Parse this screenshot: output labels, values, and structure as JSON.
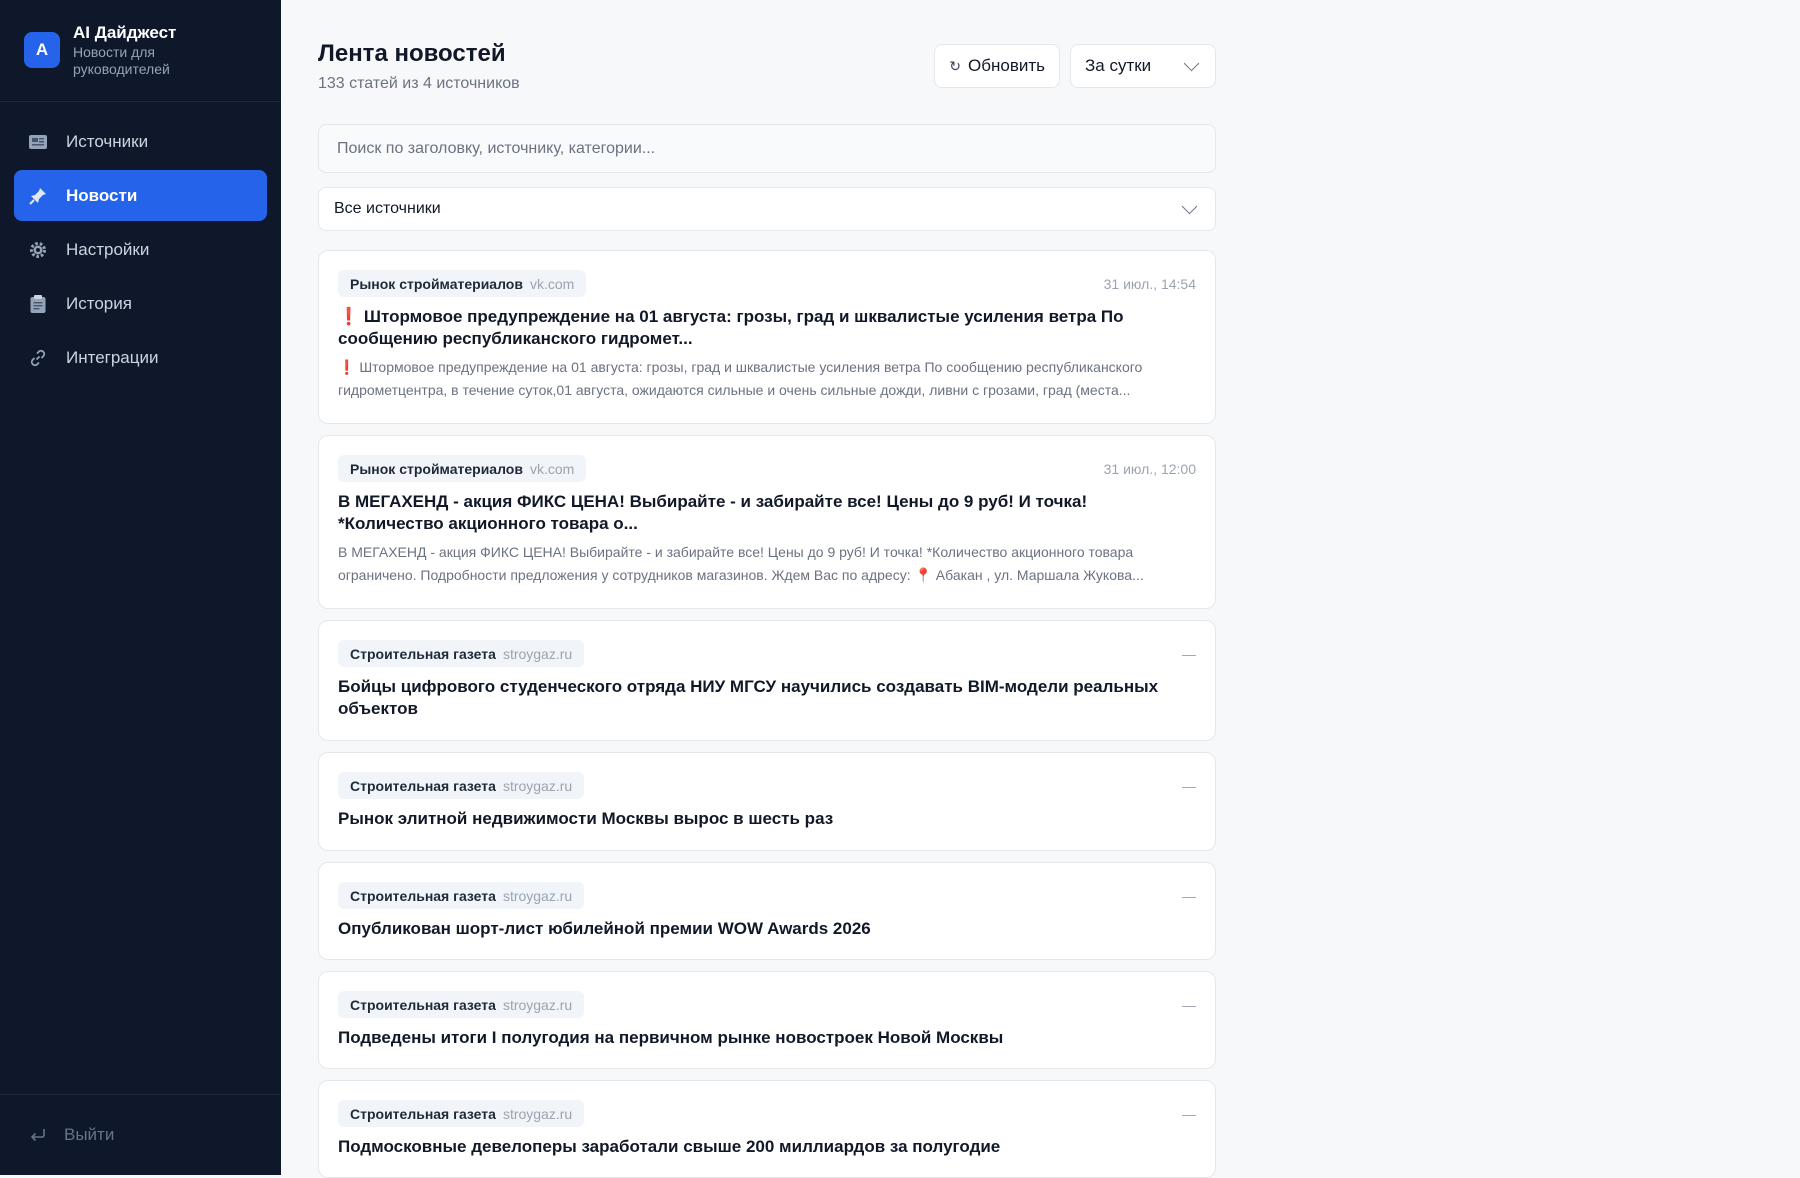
{
  "brand": {
    "logo_letter": "A",
    "title": "AI Дайджест",
    "subtitle": "Новости для руководителей"
  },
  "nav": [
    {
      "label": "Источники",
      "icon": "newspaper-icon",
      "active": false
    },
    {
      "label": "Новости",
      "icon": "pushpin-icon",
      "active": true
    },
    {
      "label": "Настройки",
      "icon": "gear-icon",
      "active": false
    },
    {
      "label": "История",
      "icon": "clipboard-icon",
      "active": false
    },
    {
      "label": "Интеграции",
      "icon": "link-icon",
      "active": false
    }
  ],
  "logout_label": "Выйти",
  "header": {
    "title": "Лента новостей",
    "subtitle": "133 статей из 4 источников",
    "refresh_label": "Обновить",
    "period_label": "За сутки"
  },
  "search": {
    "placeholder": "Поиск по заголовку, источнику, категории..."
  },
  "source_filter": {
    "label": "Все источники"
  },
  "articles": [
    {
      "source": "Рынок стройматериалов",
      "domain": "vk.com",
      "date": "31 июл., 14:54",
      "title_prefix": "❗",
      "title": "Штормовое предупреждение на 01 августа: грозы, град и шквалистые усиления ветра По сообщению республиканского гидромет...",
      "snippet_prefix": "❗",
      "snippet": "Штормовое предупреждение на 01 августа: грозы, град и шквалистые усиления ветра По сообщению республиканского гидрометцентра, в течение суток,01 августа, ожидаются сильные и очень сильные дожди, ливни с грозами, град (места..."
    },
    {
      "source": "Рынок стройматериалов",
      "domain": "vk.com",
      "date": "31 июл., 12:00",
      "title": "В МЕГАХЕНД - акция ФИКС ЦЕНА! Выбирайте - и забирайте все! Цены до 9 руб! И точка! *Количество акционного товара о...",
      "snippet_before_pin": "В МЕГАХЕНД - акция ФИКС ЦЕНА! Выбирайте - и забирайте все! Цены до 9 руб! И точка! *Количество акционного товара ограничено. Подробности предложения у сотрудников магазинов. Ждем Вас по адресу: ",
      "snippet_pin": "📍",
      "snippet_after_pin": " Абакан , ул. Маршала Жукова..."
    },
    {
      "source": "Строительная газета",
      "domain": "stroygaz.ru",
      "date": "—",
      "title": "Бойцы цифрового студенческого отряда НИУ МГСУ научились создавать BIM-модели реальных объектов"
    },
    {
      "source": "Строительная газета",
      "domain": "stroygaz.ru",
      "date": "—",
      "title": "Рынок элитной недвижимости Москвы вырос в шесть раз"
    },
    {
      "source": "Строительная газета",
      "domain": "stroygaz.ru",
      "date": "—",
      "title": "Опубликован шорт-лист юбилейной премии WOW Awards 2026"
    },
    {
      "source": "Строительная газета",
      "domain": "stroygaz.ru",
      "date": "—",
      "title": "Подведены итоги I полугодия на первичном рынке новостроек Новой Москвы"
    },
    {
      "source": "Строительная газета",
      "domain": "stroygaz.ru",
      "date": "—",
      "title": "Подмосковные девелоперы заработали свыше 200 миллиардов за полугодие"
    }
  ],
  "colors": {
    "sidebar_bg": "#0f172a",
    "accent": "#2563eb",
    "alert": "#dc2626"
  }
}
